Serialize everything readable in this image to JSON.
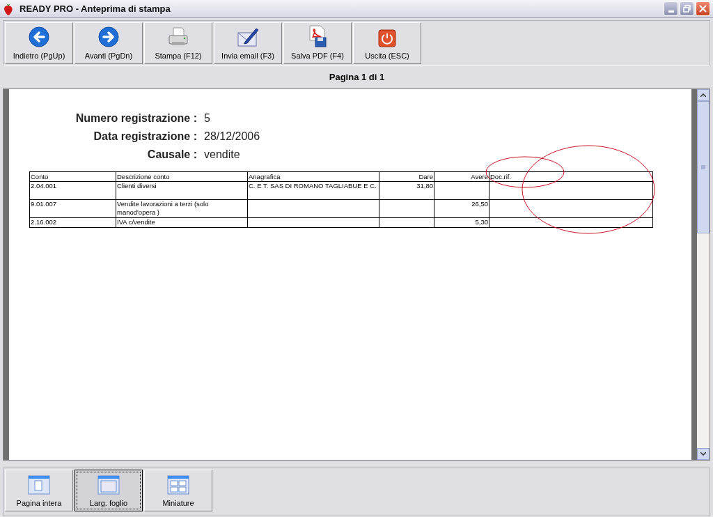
{
  "window": {
    "title": "READY PRO - Anteprima di stampa"
  },
  "toolbar": [
    {
      "kind": "back",
      "label": "Indietro (PgUp)"
    },
    {
      "kind": "forward",
      "label": "Avanti (PgDn)"
    },
    {
      "kind": "print",
      "label": "Stampa (F12)"
    },
    {
      "kind": "email",
      "label": "Invia email (F3)"
    },
    {
      "kind": "pdf",
      "label": "Salva PDF (F4)"
    },
    {
      "kind": "exit",
      "label": "Uscita (ESC)"
    }
  ],
  "page_indicator": "Pagina 1 di 1",
  "document": {
    "fields": [
      {
        "label": "Numero registrazione :",
        "value": "5"
      },
      {
        "label": "Data registrazione :",
        "value": "28/12/2006"
      },
      {
        "label": "Causale :",
        "value": "vendite"
      }
    ],
    "table": {
      "columns": [
        "Conto",
        "Descrizione conto",
        "Anagrafica",
        "Dare",
        "Avere",
        "Doc.rif."
      ],
      "rows": [
        [
          "2.04.001",
          "Clienti diversi",
          "C. E T. SAS DI ROMANO TAGLIABUE E C.",
          "31,80",
          "",
          ""
        ],
        [
          "9.01.007",
          "Vendite lavorazioni a terzi (solo manod'opera )",
          "",
          "",
          "26,50",
          ""
        ],
        [
          "2.16.002",
          "IVA c/vendite",
          "",
          "",
          "5,30",
          ""
        ]
      ]
    }
  },
  "view_buttons": [
    {
      "kind": "full",
      "label": "Pagina intera",
      "selected": false
    },
    {
      "kind": "width",
      "label": "Larg. foglio",
      "selected": true
    },
    {
      "kind": "thumbs",
      "label": "Miniature",
      "selected": false
    }
  ]
}
